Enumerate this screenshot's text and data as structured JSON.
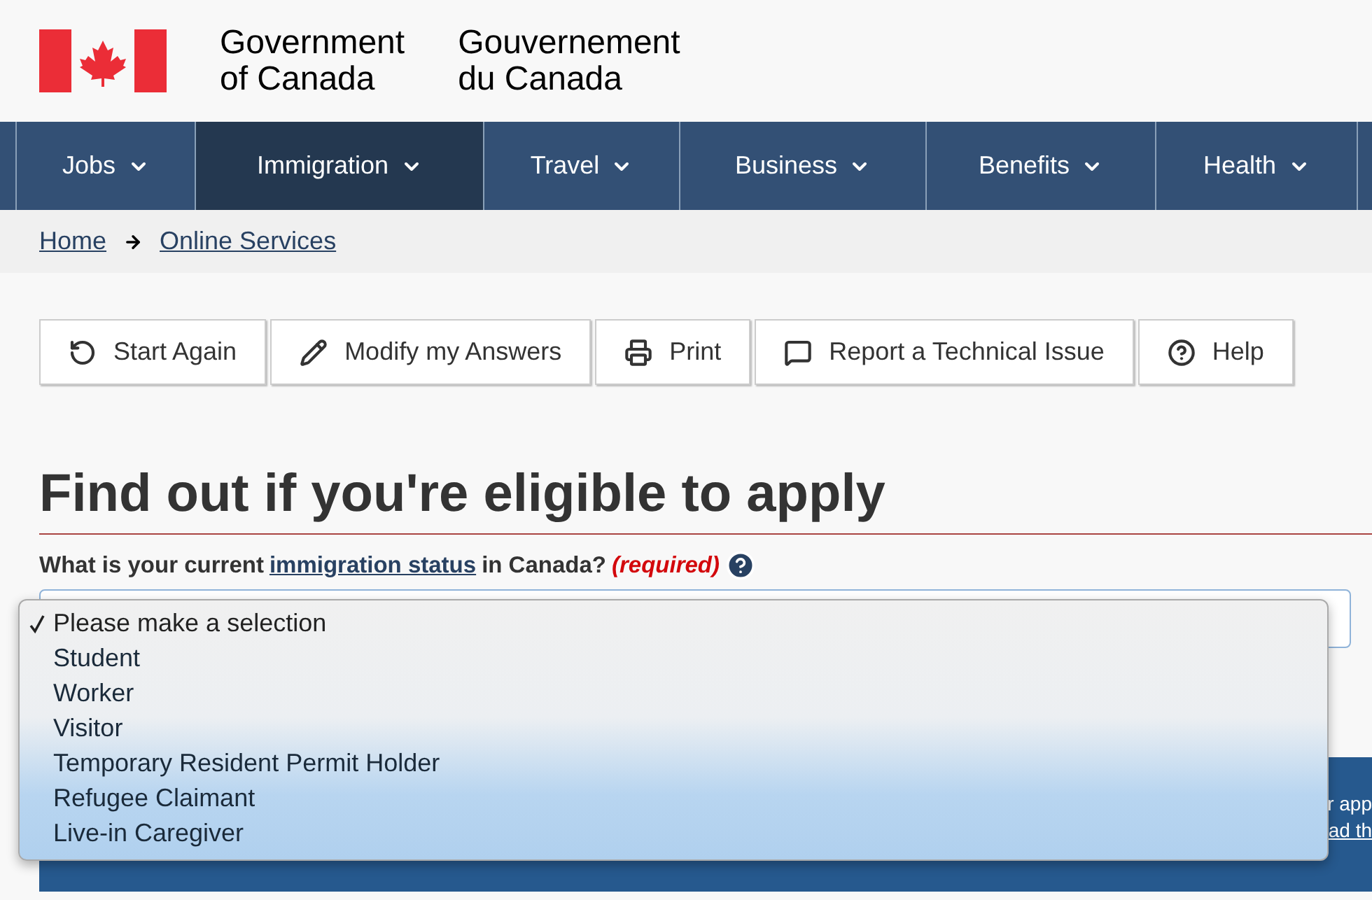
{
  "header": {
    "name_en": [
      "Government",
      "of Canada"
    ],
    "name_fr": [
      "Gouvernement",
      "du Canada"
    ]
  },
  "nav": [
    {
      "label": "Jobs",
      "selected": false
    },
    {
      "label": "Immigration",
      "selected": true
    },
    {
      "label": "Travel",
      "selected": false
    },
    {
      "label": "Business",
      "selected": false
    },
    {
      "label": "Benefits",
      "selected": false
    },
    {
      "label": "Health",
      "selected": false
    }
  ],
  "breadcrumb": [
    "Home",
    "Online Services"
  ],
  "toolbar": [
    {
      "kind": "restart",
      "label": "Start Again"
    },
    {
      "kind": "edit",
      "label": "Modify my Answers"
    },
    {
      "kind": "print",
      "label": "Print"
    },
    {
      "kind": "comment",
      "label": "Report a Technical Issue"
    },
    {
      "kind": "help",
      "label": "Help"
    }
  ],
  "heading": "Find out if you're eligible to apply",
  "question": {
    "before": "What is your current",
    "link": "immigration status",
    "after": "in Canada?",
    "required": "(required)"
  },
  "dropdown": {
    "options": [
      {
        "label": "Please make a selection",
        "selected": true
      },
      {
        "label": "Student",
        "selected": false
      },
      {
        "label": "Worker",
        "selected": false
      },
      {
        "label": "Visitor",
        "selected": false
      },
      {
        "label": "Temporary Resident Permit Holder",
        "selected": false
      },
      {
        "label": "Refugee Claimant",
        "selected": false
      },
      {
        "label": "Live-in Caregiver",
        "selected": false
      }
    ]
  },
  "panel": {
    "line_1": "r app",
    "line_2": "ad th"
  }
}
